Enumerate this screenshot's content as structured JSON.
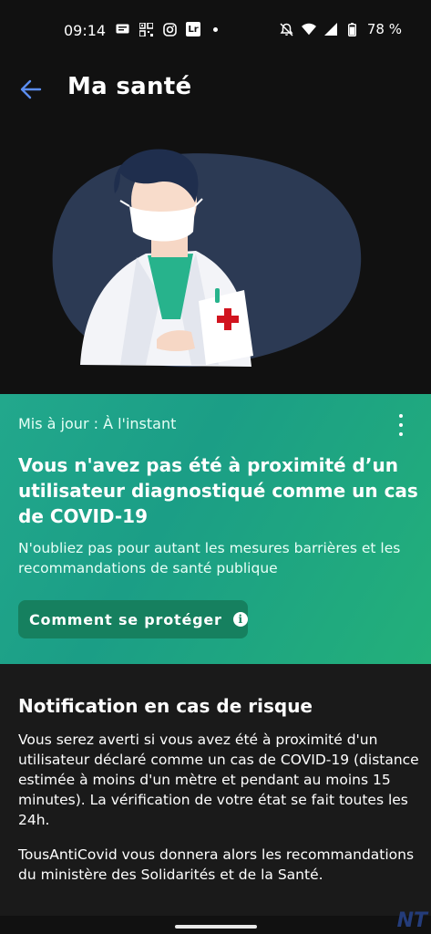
{
  "status_bar": {
    "time": "09:14",
    "battery": "78 %",
    "icons": [
      "message-icon",
      "qr-icon",
      "instagram-icon",
      "lightroom-icon",
      "dot-icon",
      "mute-icon",
      "wifi-icon",
      "signal-icon",
      "battery-icon"
    ],
    "lr_text": "Lr"
  },
  "header": {
    "title": "Ma santé",
    "accent": "#5b8def"
  },
  "card": {
    "updated": "Mis à jour : À l'instant",
    "headline": "Vous n'avez pas été à proximité d’un utilisateur diagnostiqué comme un cas de COVID-19",
    "subtitle": "N'oubliez pas pour autant les mesures barrières et les recommandations de santé publique",
    "button_label": "Comment se protéger",
    "info_glyph": "i",
    "color": "#1fa98a"
  },
  "notification": {
    "title": "Notification en cas de risque",
    "paragraph1": "Vous serez averti si vous avez été à proximité d'un utilisateur déclaré comme un cas de COVID-19 (distance estimée à moins d'un mètre et pendant au moins 15 minutes). La vérification de votre état se fait toutes les 24h.",
    "paragraph2": "TousAntiCovid vous donnera alors les recommandations du ministère des Solidarités et de la Santé."
  },
  "watermark": "NT"
}
